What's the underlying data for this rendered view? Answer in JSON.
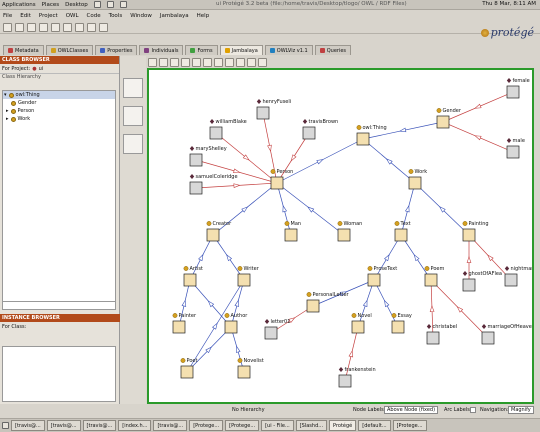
{
  "system": {
    "menu": [
      "Applications",
      "Places",
      "Desktop"
    ],
    "window_title": "ui Protégé 3.2 beta (file:/home/travis/Desktop/tlogo/ OWL / RDF Files)",
    "clock": "Thu 8 Mar, 8:11 AM"
  },
  "app_menu": [
    "File",
    "Edit",
    "Project",
    "OWL",
    "Code",
    "Tools",
    "Window",
    "Jambalaya",
    "Help"
  ],
  "logo_text": "protégé",
  "tabs": [
    {
      "label": "Metadata",
      "color": "#c04040"
    },
    {
      "label": "OWLClasses",
      "color": "#d0a020"
    },
    {
      "label": "Properties",
      "color": "#4060c0"
    },
    {
      "label": "Individuals",
      "color": "#804080"
    },
    {
      "label": "Forms",
      "color": "#40a040"
    },
    {
      "label": "Jambalaya",
      "color": "#e0a000"
    },
    {
      "label": "OWLViz v1.1",
      "color": "#2080c0"
    },
    {
      "label": "Queries",
      "color": "#c04040"
    }
  ],
  "class_browser": {
    "header": "CLASS BROWSER",
    "for_project_label": "For Project:",
    "project": "ui",
    "hierarchy_label": "Class Hierarchy",
    "tree": [
      {
        "label": "owl:Thing",
        "level": 0,
        "selected": true
      },
      {
        "label": "Gender",
        "level": 1
      },
      {
        "label": "Person",
        "level": 1
      },
      {
        "label": "Work",
        "level": 1
      }
    ]
  },
  "instance_browser": {
    "header": "INSTANCE BROWSER",
    "for_class_label": "For Class:"
  },
  "graph": {
    "nodes": [
      {
        "id": "owlthing",
        "label": "owl:Thing",
        "kind": "class"
      },
      {
        "id": "gender",
        "label": "Gender",
        "kind": "class"
      },
      {
        "id": "female",
        "label": "female",
        "kind": "instance"
      },
      {
        "id": "male",
        "label": "male",
        "kind": "instance"
      },
      {
        "id": "person",
        "label": "Person",
        "kind": "class"
      },
      {
        "id": "work",
        "label": "Work",
        "kind": "class"
      },
      {
        "id": "williamblake",
        "label": "williamBlake",
        "kind": "instance"
      },
      {
        "id": "henryfuseli",
        "label": "henryFuseli",
        "kind": "instance"
      },
      {
        "id": "travisbrown",
        "label": "travisBrown",
        "kind": "instance"
      },
      {
        "id": "maryshelley",
        "label": "maryShelley",
        "kind": "instance"
      },
      {
        "id": "samuelcoleridge",
        "label": "samuelColeridge",
        "kind": "instance"
      },
      {
        "id": "creator",
        "label": "Creator",
        "kind": "class"
      },
      {
        "id": "man",
        "label": "Man",
        "kind": "class"
      },
      {
        "id": "woman",
        "label": "Woman",
        "kind": "class"
      },
      {
        "id": "text",
        "label": "Text",
        "kind": "class"
      },
      {
        "id": "painting",
        "label": "Painting",
        "kind": "class"
      },
      {
        "id": "artist",
        "label": "Artist",
        "kind": "class"
      },
      {
        "id": "writer",
        "label": "Writer",
        "kind": "class"
      },
      {
        "id": "prosetext",
        "label": "ProseText",
        "kind": "class"
      },
      {
        "id": "poem",
        "label": "Poem",
        "kind": "class"
      },
      {
        "id": "ghostofaflea",
        "label": "ghostOfAFlea",
        "kind": "instance"
      },
      {
        "id": "nightmare",
        "label": "nightmare",
        "kind": "instance"
      },
      {
        "id": "personalletter",
        "label": "PersonalLetter",
        "kind": "class"
      },
      {
        "id": "painter",
        "label": "Painter",
        "kind": "class"
      },
      {
        "id": "author",
        "label": "Author",
        "kind": "class"
      },
      {
        "id": "letter01",
        "label": "letter01",
        "kind": "instance"
      },
      {
        "id": "novel",
        "label": "Novel",
        "kind": "class"
      },
      {
        "id": "essay",
        "label": "Essay",
        "kind": "class"
      },
      {
        "id": "christabel",
        "label": "christabel",
        "kind": "instance"
      },
      {
        "id": "marriageofheaven",
        "label": "marriageOfHeaven",
        "kind": "instance"
      },
      {
        "id": "poet",
        "label": "Poet",
        "kind": "class"
      },
      {
        "id": "novelist",
        "label": "Novelist",
        "kind": "class"
      },
      {
        "id": "frankenstein",
        "label": "frankenstein",
        "kind": "instance"
      }
    ]
  },
  "status_bar": {
    "hierarchy": "No Hierarchy",
    "node_labels_label": "Node Labels:",
    "node_labels_value": "Above Node (fixed)",
    "arc_labels_label": "Arc Labels:",
    "navigation_label": "Navigation:",
    "navigation_value": "Magnify"
  },
  "taskbar": [
    "[travis@...",
    "[travis@...",
    "[travis@...",
    "[index.h...",
    "[travis@...",
    "[Protege...",
    "[Protege...",
    "[ui - File...",
    "[Slashd...",
    "Protégé",
    "[default...",
    "[Protege..."
  ]
}
